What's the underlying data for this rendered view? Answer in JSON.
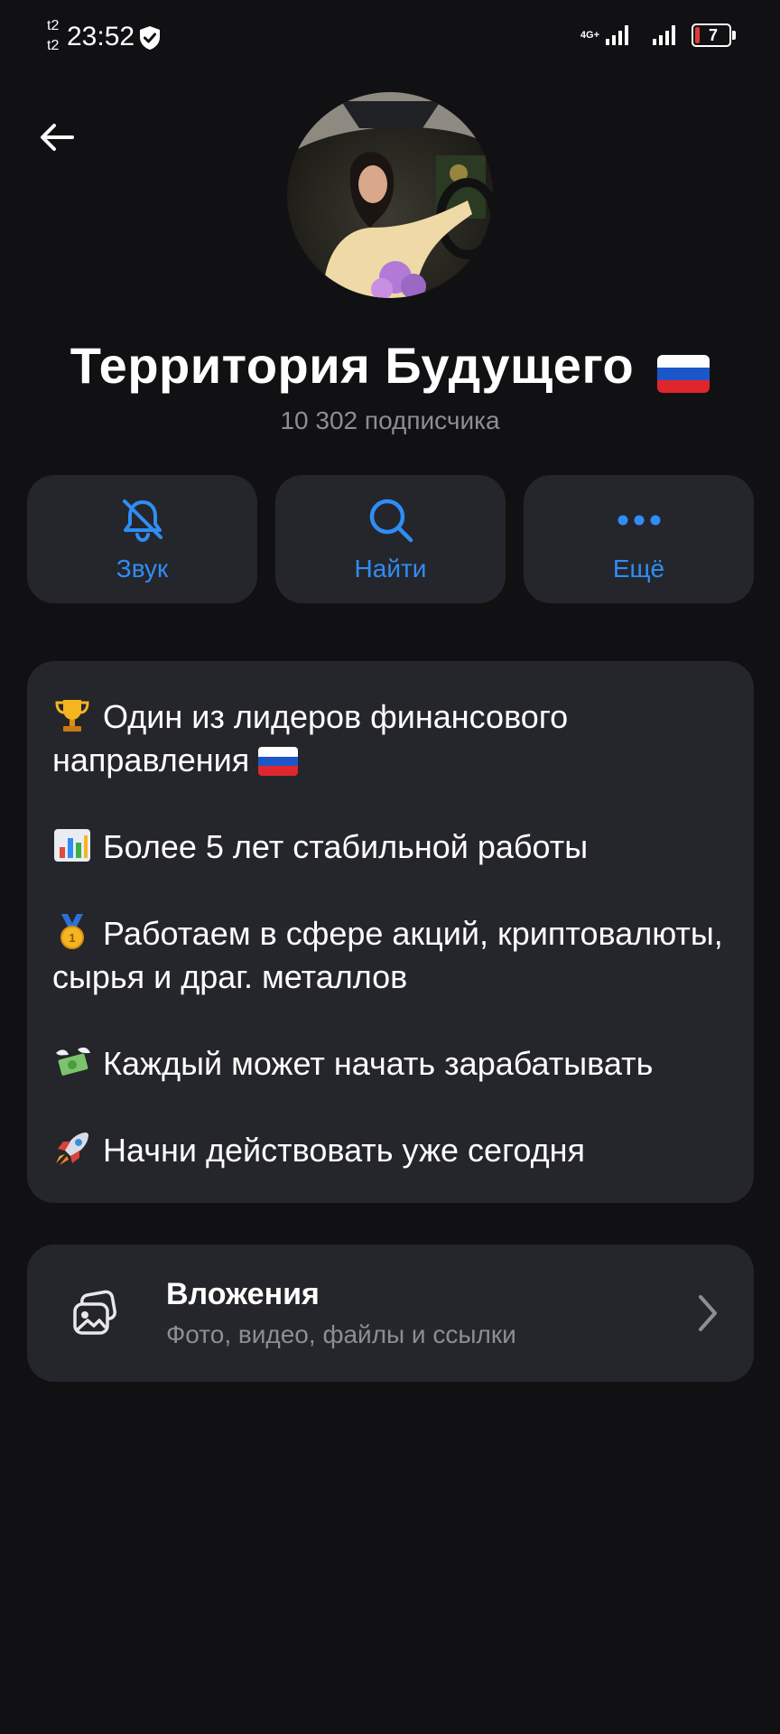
{
  "status_bar": {
    "carrier_top": "t2",
    "carrier_bottom": "t2",
    "time": "23:52",
    "network": "4G+",
    "battery": "7"
  },
  "channel": {
    "name": "Территория Будущего",
    "subscribers": "10 302 подписчика"
  },
  "actions": [
    {
      "label": "Звук",
      "icon": "bell-off-icon"
    },
    {
      "label": "Найти",
      "icon": "search-icon"
    },
    {
      "label": "Ещё",
      "icon": "more-dots-icon"
    }
  ],
  "description": [
    {
      "emoji": "trophy",
      "text": "Один из лидеров финансового направления",
      "flag": "ru-flag"
    },
    {
      "emoji": "bar-chart",
      "text": "Более 5 лет стабильной работы"
    },
    {
      "emoji": "medal",
      "text": "Работаем в сфере акций, криптовалюты, сырья и драг. металлов"
    },
    {
      "emoji": "money-wings",
      "text": "Каждый может начать зарабатывать"
    },
    {
      "emoji": "rocket",
      "text": "Начни действовать уже сегодня"
    }
  ],
  "attachments": {
    "title": "Вложения",
    "subtitle": "Фото, видео, файлы и ссылки",
    "icon": "media-gallery-icon"
  },
  "colors": {
    "background": "#111114",
    "card": "#25262b",
    "accent": "#2f8df5",
    "secondary_text": "#8d8e93"
  }
}
